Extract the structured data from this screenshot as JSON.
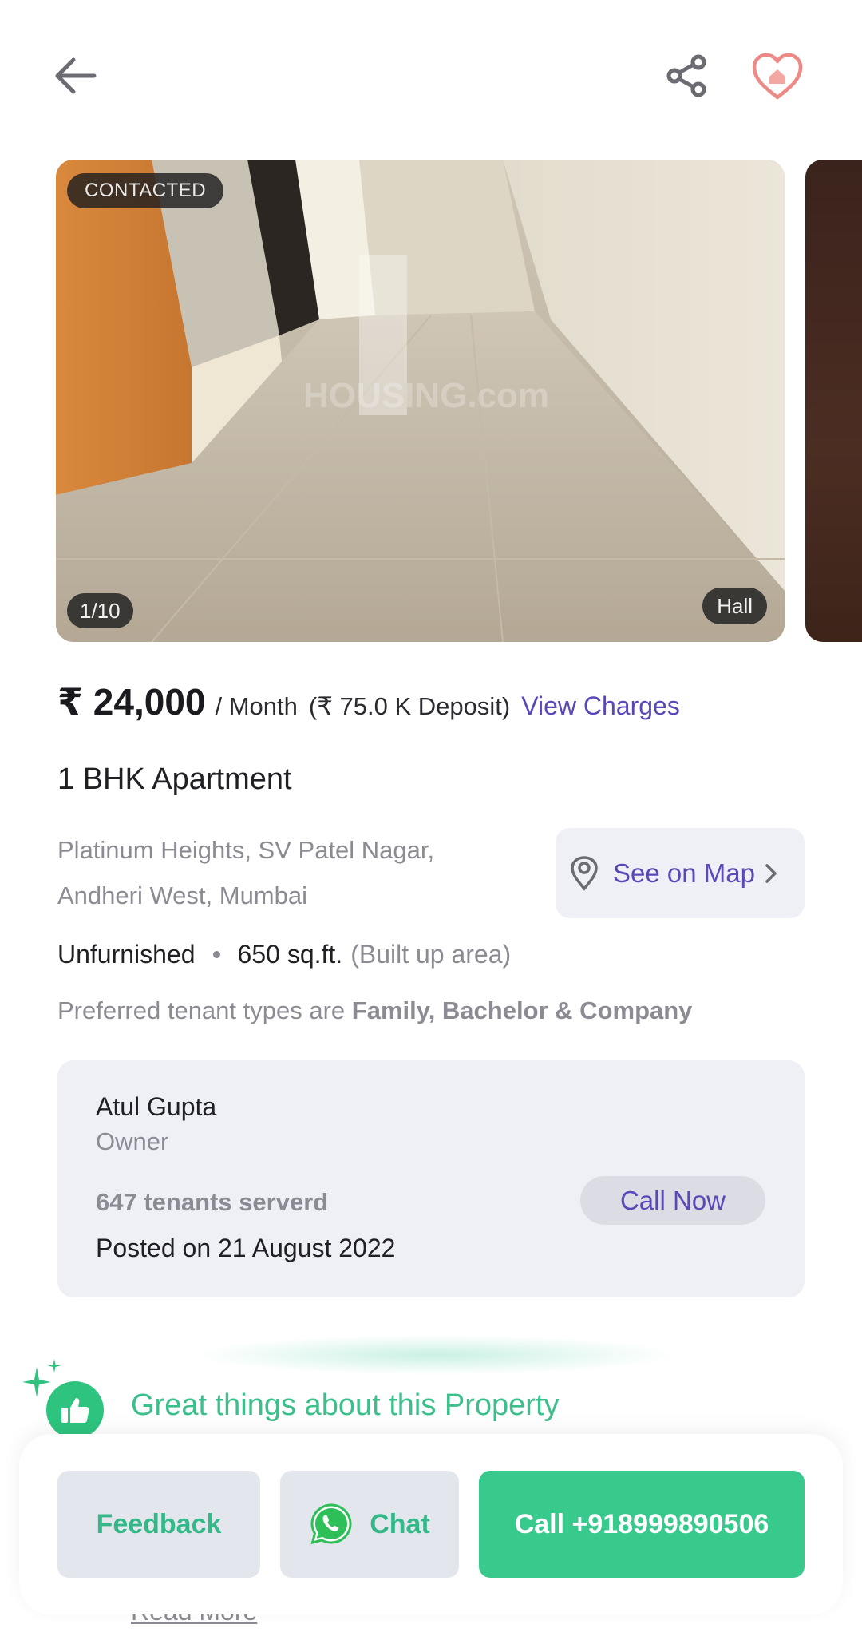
{
  "gallery": {
    "status_badge": "CONTACTED",
    "counter": "1/10",
    "room_label": "Hall"
  },
  "pricing": {
    "rent": "₹ 24,000",
    "period": "/ Month",
    "deposit": "(₹ 75.0 K Deposit)",
    "view_charges": "View Charges"
  },
  "property": {
    "title": "1 BHK Apartment",
    "address_line1": "Platinum Heights, SV Patel Nagar,",
    "address_line2": "Andheri West, Mumbai",
    "map_button": "See on Map",
    "furnishing": "Unfurnished",
    "area": "650 sq.ft.",
    "area_note": "(Built up area)",
    "tenants_prefix": "Preferred tenant types are",
    "tenants_types": "Family, Bachelor & Company"
  },
  "owner": {
    "name": "Atul Gupta",
    "role": "Owner",
    "served": "647 tenants serverd",
    "posted": "Posted on 21 August 2022",
    "call_now": "Call Now"
  },
  "highlights": {
    "title": "Great things about this Property",
    "read_more": "Read More"
  },
  "actions": {
    "feedback": "Feedback",
    "chat": "Chat",
    "call": "Call +918999890506"
  },
  "colors": {
    "accent_purple": "#5a48b8",
    "accent_green": "#38c98d",
    "heart_pink": "#ee8a86"
  },
  "icons": [
    "back-arrow-icon",
    "share-icon",
    "heart-home-icon",
    "map-pin-icon",
    "chevron-right-icon",
    "thumbs-up-icon",
    "sparkle-icon",
    "whatsapp-icon"
  ]
}
